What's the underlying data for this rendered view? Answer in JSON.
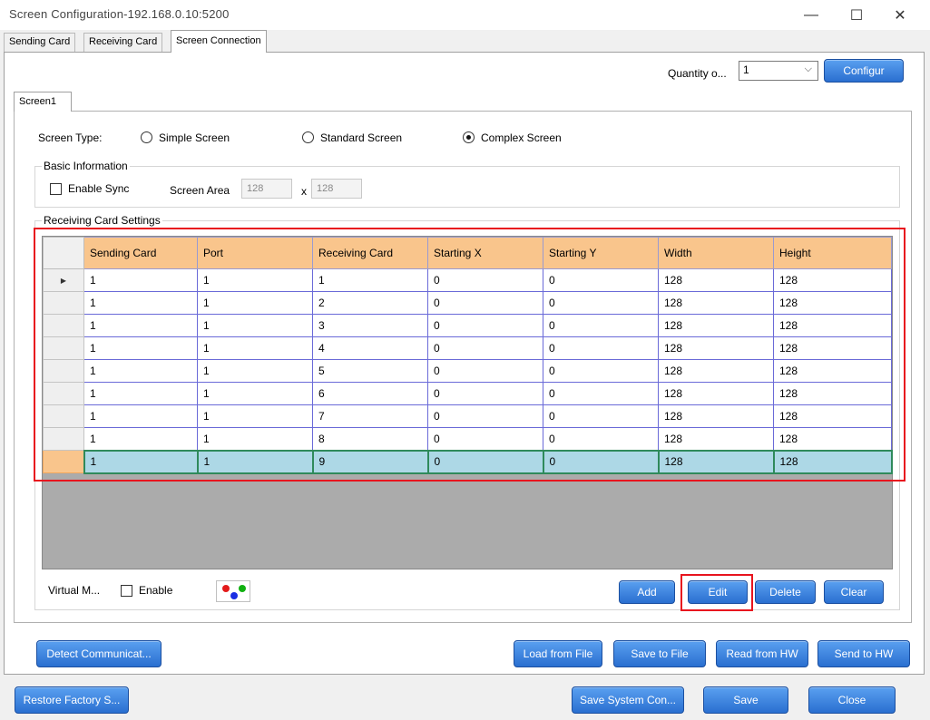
{
  "window": {
    "title": "Screen Configuration-192.168.0.10:5200",
    "minimize_glyph": "—",
    "maximize_glyph": "☐",
    "close_glyph": "✕"
  },
  "tabs": [
    {
      "label": "Sending Card"
    },
    {
      "label": "Receiving Card"
    },
    {
      "label": "Screen Connection"
    }
  ],
  "quantity": {
    "label": "Quantity o...",
    "value": "1",
    "button": "Configur"
  },
  "screen_tab": {
    "label": "Screen1"
  },
  "screen_type": {
    "label": "Screen Type:",
    "options": [
      "Simple Screen",
      "Standard Screen",
      "Complex Screen"
    ],
    "selected": "Complex Screen"
  },
  "basic_info": {
    "title": "Basic Information",
    "enable_sync": "Enable Sync",
    "screen_area_label": "Screen Area",
    "width": "128",
    "x_sep": "x",
    "height": "128"
  },
  "receiving_settings": {
    "title": "Receiving Card Settings"
  },
  "table": {
    "columns": [
      "Sending Card",
      "Port",
      "Receiving Card",
      "Starting X",
      "Starting Y",
      "Width",
      "Height"
    ],
    "rows": [
      [
        "1",
        "1",
        "1",
        "0",
        "0",
        "128",
        "128"
      ],
      [
        "1",
        "1",
        "2",
        "0",
        "0",
        "128",
        "128"
      ],
      [
        "1",
        "1",
        "3",
        "0",
        "0",
        "128",
        "128"
      ],
      [
        "1",
        "1",
        "4",
        "0",
        "0",
        "128",
        "128"
      ],
      [
        "1",
        "1",
        "5",
        "0",
        "0",
        "128",
        "128"
      ],
      [
        "1",
        "1",
        "6",
        "0",
        "0",
        "128",
        "128"
      ],
      [
        "1",
        "1",
        "7",
        "0",
        "0",
        "128",
        "128"
      ],
      [
        "1",
        "1",
        "8",
        "0",
        "0",
        "128",
        "128"
      ],
      [
        "1",
        "1",
        "9",
        "0",
        "0",
        "128",
        "128"
      ]
    ],
    "current_row_marker": "▶",
    "selected_row": 8
  },
  "virtual": {
    "label": "Virtual M...",
    "enable": "Enable"
  },
  "table_buttons": {
    "add": "Add",
    "edit": "Edit",
    "delete": "Delete",
    "clear": "Clear"
  },
  "bottom_buttons": {
    "detect": "Detect Communicat...",
    "load": "Load from File",
    "save_file": "Save to File",
    "read_hw": "Read from HW",
    "send_hw": "Send to HW",
    "restore": "Restore Factory S...",
    "save_system": "Save System Con...",
    "save": "Save",
    "close": "Close"
  },
  "colors": {
    "header_bg": "#f9c58c",
    "selected_row_bg": "#add8e6",
    "highlight_box": "#e8141e",
    "button_blue": "#2a6fd0"
  }
}
